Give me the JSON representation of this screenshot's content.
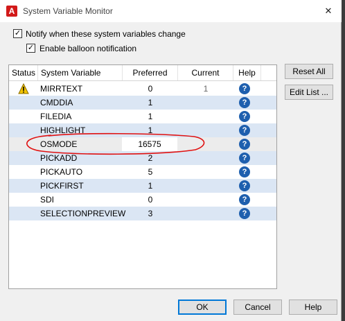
{
  "window": {
    "title": "System Variable Monitor",
    "app_icon_letter": "A",
    "close_glyph": "✕"
  },
  "options": {
    "notify_label": "Notify when these system variables change",
    "notify_checked": true,
    "balloon_label": "Enable balloon notification",
    "balloon_checked": true
  },
  "grid": {
    "headers": {
      "status": "Status",
      "variable": "System Variable",
      "preferred": "Preferred",
      "current": "Current",
      "help": "Help"
    },
    "rows": [
      {
        "name": "MIRRTEXT",
        "preferred": "0",
        "current": "1",
        "status": "warning"
      },
      {
        "name": "CMDDIA",
        "preferred": "1",
        "current": "",
        "status": ""
      },
      {
        "name": "FILEDIA",
        "preferred": "1",
        "current": "",
        "status": ""
      },
      {
        "name": "HIGHLIGHT",
        "preferred": "1",
        "current": "",
        "status": ""
      },
      {
        "name": "OSMODE",
        "preferred": "16575",
        "current": "",
        "status": ""
      },
      {
        "name": "PICKADD",
        "preferred": "2",
        "current": "",
        "status": ""
      },
      {
        "name": "PICKAUTO",
        "preferred": "5",
        "current": "",
        "status": ""
      },
      {
        "name": "PICKFIRST",
        "preferred": "1",
        "current": "",
        "status": ""
      },
      {
        "name": "SDI",
        "preferred": "0",
        "current": "",
        "status": ""
      },
      {
        "name": "SELECTIONPREVIEW",
        "preferred": "3",
        "current": "",
        "status": ""
      }
    ],
    "help_glyph": "?"
  },
  "side_buttons": {
    "reset_all": "Reset All",
    "edit_list": "Edit List ..."
  },
  "footer": {
    "ok": "OK",
    "cancel": "Cancel",
    "help": "Help"
  },
  "colors": {
    "row_alt": "#dbe6f4",
    "help_icon": "#1e5fae",
    "annotation": "#e01010"
  }
}
